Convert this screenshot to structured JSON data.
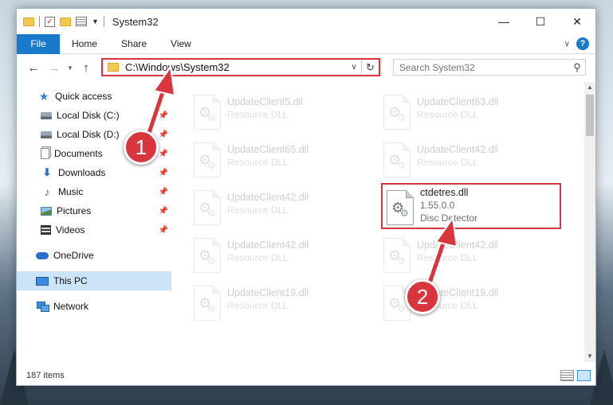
{
  "window": {
    "title": "System32",
    "controls": {
      "minimize": "—",
      "maximize": "☐",
      "close": "✕"
    }
  },
  "ribbon": {
    "file": "File",
    "tabs": [
      "Home",
      "Share",
      "View"
    ]
  },
  "navigation": {
    "address": "C:\\Windows\\System32",
    "search_placeholder": "Search System32"
  },
  "sidebar": {
    "items": [
      {
        "label": "Quick access",
        "icon": "star-icon",
        "pinned": false
      },
      {
        "label": "Local Disk (C:)",
        "icon": "drive-icon",
        "pinned": true
      },
      {
        "label": "Local Disk (D:)",
        "icon": "drive-icon",
        "pinned": true
      },
      {
        "label": "Documents",
        "icon": "documents-icon",
        "pinned": true
      },
      {
        "label": "Downloads",
        "icon": "downloads-icon",
        "pinned": true
      },
      {
        "label": "Music",
        "icon": "music-icon",
        "pinned": true
      },
      {
        "label": "Pictures",
        "icon": "pictures-icon",
        "pinned": true
      },
      {
        "label": "Videos",
        "icon": "videos-icon",
        "pinned": true
      },
      {
        "label": "OneDrive",
        "icon": "onedrive-icon",
        "pinned": false
      },
      {
        "label": "This PC",
        "icon": "this-pc-icon",
        "pinned": false,
        "selected": true
      },
      {
        "label": "Network",
        "icon": "network-icon",
        "pinned": false
      }
    ]
  },
  "files": [
    {
      "name": "UpdateClient5.dll",
      "type": "Resource DLL"
    },
    {
      "name": "UpdateClient63.dll",
      "type": "Resource DLL"
    },
    {
      "name": "UpdateClient65.dll",
      "type": "Resource DLL"
    },
    {
      "name": "UpdateClient42.dll",
      "type": "Resource DLL"
    },
    {
      "name": "UpdateClient42.dll",
      "type": "Resource DLL"
    },
    {
      "name": "ctdetres.dll",
      "version": "1.55.0.0",
      "type": "Disc Detector"
    },
    {
      "name": "UpdateClient42.dll",
      "type": "Resource DLL"
    },
    {
      "name": "UpdateClient42.dll",
      "type": "Resource DLL"
    },
    {
      "name": "UpdateClient19.dll",
      "type": "Resource DLL"
    },
    {
      "name": "UpdateClient19.dll",
      "type": "Resource DLL"
    }
  ],
  "status": {
    "item_count": "187 items"
  },
  "annotations": {
    "step1": "1",
    "step2": "2"
  },
  "colors": {
    "highlight": "#d9353d",
    "accent": "#1979ca",
    "selected": "#cce4f7"
  }
}
